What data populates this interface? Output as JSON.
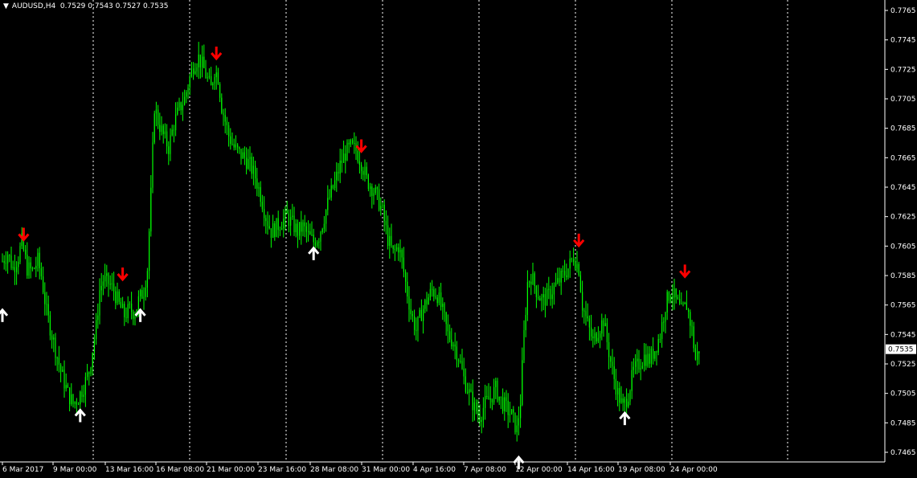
{
  "header": {
    "symbol": "AUDUSD,H4",
    "ohlc": "0.7529 0.7543 0.7527 0.7535"
  },
  "colors": {
    "background": "#000000",
    "candles": "#00ff00",
    "grid": "#ffffff",
    "sell_arrow": "#ff0000",
    "buy_arrow": "#ffffff"
  },
  "chart_data": {
    "type": "candlestick",
    "instrument": "AUDUSD",
    "timeframe": "H4",
    "ylim": [
      0.7455,
      0.7775
    ],
    "y_ticks": [
      "0.7765",
      "0.7745",
      "0.7725",
      "0.7705",
      "0.7685",
      "0.7665",
      "0.7645",
      "0.7625",
      "0.7605",
      "0.7585",
      "0.7565",
      "0.7545",
      "0.7525",
      "0.7505",
      "0.7485",
      "0.7465"
    ],
    "current_price": "0.7535",
    "x_ticks": [
      "6 Mar 2017",
      "9 Mar 00:00",
      "13 Mar 16:00",
      "16 Mar 08:00",
      "21 Mar 00:00",
      "23 Mar 16:00",
      "28 Mar 08:00",
      "31 Mar 00:00",
      "4 Apr 16:00",
      "7 Apr 08:00",
      "12 Apr 00:00",
      "14 Apr 16:00",
      "19 Apr 08:00",
      "24 Apr 00:00"
    ],
    "grid": "vertical dotted",
    "close_path": [
      [
        0,
        0.7595
      ],
      [
        3,
        0.76
      ],
      [
        6,
        0.759
      ],
      [
        9,
        0.7598
      ],
      [
        11,
        0.7608
      ],
      [
        14,
        0.759
      ],
      [
        17,
        0.7588
      ],
      [
        20,
        0.7595
      ],
      [
        22,
        0.7585
      ],
      [
        25,
        0.756
      ],
      [
        29,
        0.754
      ],
      [
        33,
        0.752
      ],
      [
        37,
        0.7505
      ],
      [
        40,
        0.7498
      ],
      [
        43,
        0.7502
      ],
      [
        46,
        0.751
      ],
      [
        49,
        0.752
      ],
      [
        51,
        0.7535
      ],
      [
        53,
        0.755
      ],
      [
        55,
        0.7575
      ],
      [
        57,
        0.7582
      ],
      [
        60,
        0.758
      ],
      [
        63,
        0.7575
      ],
      [
        66,
        0.7565
      ],
      [
        69,
        0.7558
      ],
      [
        72,
        0.7562
      ],
      [
        75,
        0.756
      ],
      [
        77,
        0.7568
      ],
      [
        80,
        0.7575
      ],
      [
        82,
        0.759
      ],
      [
        84,
        0.764
      ],
      [
        86,
        0.77
      ],
      [
        88,
        0.769
      ],
      [
        91,
        0.768
      ],
      [
        94,
        0.7672
      ],
      [
        97,
        0.7688
      ],
      [
        100,
        0.7698
      ],
      [
        103,
        0.7705
      ],
      [
        105,
        0.7715
      ],
      [
        108,
        0.7728
      ],
      [
        111,
        0.7733
      ],
      [
        114,
        0.7725
      ],
      [
        116,
        0.7718
      ],
      [
        118,
        0.7712
      ],
      [
        120,
        0.7725
      ],
      [
        122,
        0.772
      ],
      [
        124,
        0.77
      ],
      [
        126,
        0.769
      ],
      [
        128,
        0.768
      ],
      [
        131,
        0.7672
      ],
      [
        134,
        0.7668
      ],
      [
        137,
        0.7665
      ],
      [
        140,
        0.766
      ],
      [
        143,
        0.7652
      ],
      [
        146,
        0.764
      ],
      [
        149,
        0.7625
      ],
      [
        152,
        0.7615
      ],
      [
        155,
        0.7618
      ],
      [
        158,
        0.7622
      ],
      [
        161,
        0.7625
      ],
      [
        164,
        0.762
      ],
      [
        167,
        0.7615
      ],
      [
        170,
        0.7618
      ],
      [
        173,
        0.7612
      ],
      [
        176,
        0.7608
      ],
      [
        179,
        0.7612
      ],
      [
        182,
        0.7625
      ],
      [
        185,
        0.7638
      ],
      [
        188,
        0.7648
      ],
      [
        191,
        0.766
      ],
      [
        194,
        0.7668
      ],
      [
        197,
        0.7672
      ],
      [
        200,
        0.767
      ],
      [
        203,
        0.7662
      ],
      [
        206,
        0.765
      ],
      [
        209,
        0.7645
      ],
      [
        212,
        0.7638
      ],
      [
        215,
        0.7628
      ],
      [
        218,
        0.761
      ],
      [
        221,
        0.76
      ],
      [
        224,
        0.7605
      ],
      [
        226,
        0.7595
      ],
      [
        228,
        0.758
      ],
      [
        231,
        0.756
      ],
      [
        234,
        0.7548
      ],
      [
        237,
        0.756
      ],
      [
        240,
        0.7568
      ],
      [
        243,
        0.7575
      ],
      [
        246,
        0.7572
      ],
      [
        249,
        0.756
      ],
      [
        252,
        0.7545
      ],
      [
        255,
        0.754
      ],
      [
        258,
        0.753
      ],
      [
        261,
        0.7515
      ],
      [
        264,
        0.7505
      ],
      [
        267,
        0.7495
      ],
      [
        270,
        0.749
      ],
      [
        273,
        0.7498
      ],
      [
        276,
        0.7502
      ],
      [
        279,
        0.7508
      ],
      [
        282,
        0.75
      ],
      [
        285,
        0.7495
      ],
      [
        288,
        0.749
      ],
      [
        291,
        0.748
      ],
      [
        293,
        0.75
      ],
      [
        295,
        0.7545
      ],
      [
        297,
        0.758
      ],
      [
        299,
        0.7585
      ],
      [
        302,
        0.7575
      ],
      [
        305,
        0.7568
      ],
      [
        308,
        0.757
      ],
      [
        311,
        0.7575
      ],
      [
        314,
        0.758
      ],
      [
        317,
        0.7585
      ],
      [
        320,
        0.759
      ],
      [
        323,
        0.7598
      ],
      [
        326,
        0.759
      ],
      [
        328,
        0.7565
      ],
      [
        331,
        0.7552
      ],
      [
        334,
        0.754
      ],
      [
        337,
        0.7548
      ],
      [
        340,
        0.7555
      ],
      [
        342,
        0.754
      ],
      [
        345,
        0.752
      ],
      [
        348,
        0.7505
      ],
      [
        351,
        0.7495
      ],
      [
        354,
        0.7505
      ],
      [
        357,
        0.752
      ],
      [
        360,
        0.7525
      ],
      [
        363,
        0.753
      ],
      [
        366,
        0.7528
      ],
      [
        369,
        0.7535
      ],
      [
        372,
        0.7545
      ],
      [
        375,
        0.7565
      ],
      [
        378,
        0.7575
      ],
      [
        381,
        0.7568
      ],
      [
        384,
        0.756
      ],
      [
        387,
        0.7565
      ],
      [
        390,
        0.7548
      ],
      [
        392,
        0.7528
      ],
      [
        394,
        0.7535
      ]
    ],
    "signals": [
      {
        "type": "sell",
        "time_index": 12,
        "price": 0.7612
      },
      {
        "type": "buy",
        "time_index": 0,
        "price": 0.756
      },
      {
        "type": "sell",
        "time_index": 68,
        "price": 0.7585
      },
      {
        "type": "buy",
        "time_index": 44,
        "price": 0.7492
      },
      {
        "type": "buy",
        "time_index": 78,
        "price": 0.756
      },
      {
        "type": "sell",
        "time_index": 121,
        "price": 0.7735
      },
      {
        "type": "buy",
        "time_index": 176,
        "price": 0.7602
      },
      {
        "type": "sell",
        "time_index": 203,
        "price": 0.7672
      },
      {
        "type": "buy",
        "time_index": 292,
        "price": 0.746
      },
      {
        "type": "sell",
        "time_index": 326,
        "price": 0.7608
      },
      {
        "type": "buy",
        "time_index": 352,
        "price": 0.749
      },
      {
        "type": "sell",
        "time_index": 386,
        "price": 0.7587
      }
    ]
  }
}
